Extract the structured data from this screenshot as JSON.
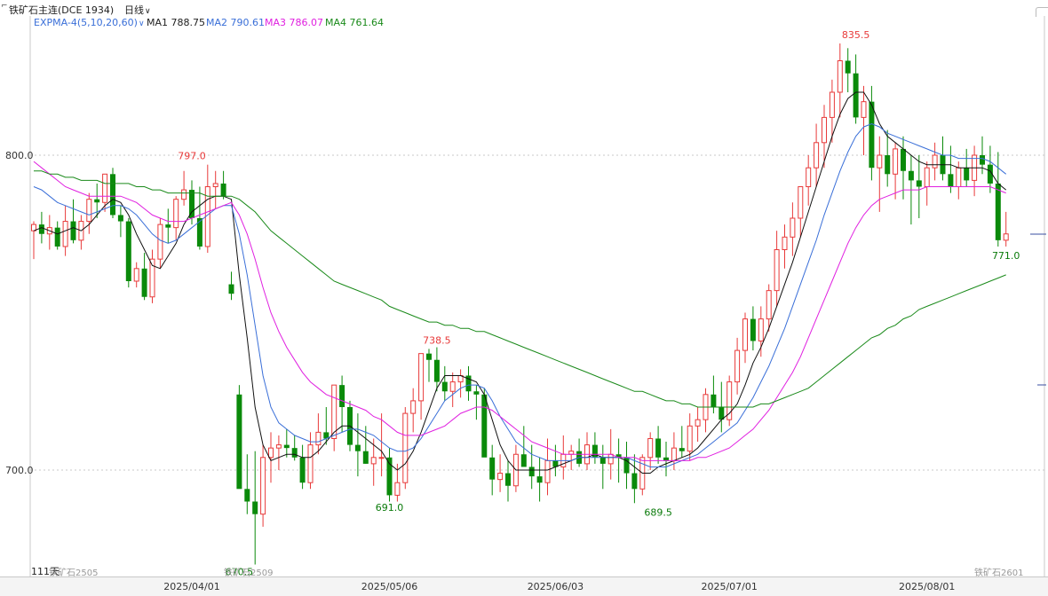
{
  "header": {
    "instrument": "铁矿石主连(DCE 1934)",
    "period": "日线",
    "indicator": "EXPMA-4(5,10,20,60)",
    "ma": [
      {
        "label": "MA1",
        "value": "788.75",
        "color": "#111111"
      },
      {
        "label": "MA2",
        "value": "790.61",
        "color": "#3a6fd8"
      },
      {
        "label": "MA3",
        "value": "786.07",
        "color": "#e020e0"
      },
      {
        "label": "MA4",
        "value": "761.64",
        "color": "#1a8a1a"
      }
    ]
  },
  "footer": {
    "days": "111天",
    "contract_left": "铁矿石2505",
    "contract_mid": "铁矿石2509",
    "contract_right": "铁矿石2601"
  },
  "icons": {
    "expand": "chevron-down-icon",
    "top_left": "corner-icon"
  },
  "colors": {
    "up": "#e83a3a",
    "down": "#0a8a0a",
    "grid": "#c8c8c8",
    "ma1": "#111111",
    "ma2": "#3a6fd8",
    "ma3": "#e020e0",
    "ma4": "#1a8a1a"
  },
  "chart_data": {
    "type": "candlestick",
    "yticks": [
      800,
      700
    ],
    "ylim": [
      665,
      850
    ],
    "xticks": [
      "2025/04/01",
      "2025/05/06",
      "2025/06/03",
      "2025/07/01",
      "2025/08/01"
    ],
    "xtick_index": [
      20,
      45,
      66,
      88,
      113
    ],
    "annotations": [
      {
        "index": 20,
        "value": 797.0,
        "label": "797.0",
        "kind": "high"
      },
      {
        "index": 26,
        "value": 670.5,
        "label": "670.5",
        "kind": "low"
      },
      {
        "index": 45,
        "value": 691.0,
        "label": "691.0",
        "kind": "low"
      },
      {
        "index": 51,
        "value": 738.5,
        "label": "738.5",
        "kind": "high"
      },
      {
        "index": 79,
        "value": 689.5,
        "label": "689.5",
        "kind": "low"
      },
      {
        "index": 104,
        "value": 835.5,
        "label": "835.5",
        "kind": "high"
      },
      {
        "index": 123,
        "value": 771.0,
        "label": "771.0",
        "kind": "low"
      }
    ],
    "candles": [
      [
        776,
        779,
        767,
        778
      ],
      [
        778,
        782,
        772,
        775
      ],
      [
        775,
        781,
        770,
        777
      ],
      [
        777,
        779,
        770,
        771
      ],
      [
        771,
        784,
        768,
        779
      ],
      [
        779,
        786,
        772,
        773
      ],
      [
        773,
        781,
        770,
        779
      ],
      [
        779,
        788,
        775,
        786
      ],
      [
        786,
        791,
        780,
        785
      ],
      [
        785,
        792,
        782,
        794
      ],
      [
        794,
        796,
        780,
        781
      ],
      [
        781,
        784,
        774,
        779
      ],
      [
        779,
        780,
        758,
        760
      ],
      [
        760,
        766,
        758,
        764
      ],
      [
        764,
        769,
        754,
        755
      ],
      [
        755,
        770,
        753,
        767
      ],
      [
        767,
        780,
        764,
        778
      ],
      [
        778,
        783,
        772,
        777
      ],
      [
        777,
        787,
        773,
        786
      ],
      [
        786,
        795,
        784,
        789
      ],
      [
        789,
        792,
        778,
        780
      ],
      [
        780,
        790,
        770,
        771
      ],
      [
        771,
        797,
        769,
        790
      ],
      [
        790,
        795,
        783,
        791
      ],
      [
        791,
        795,
        786,
        787
      ],
      [
        759,
        763,
        754,
        756
      ],
      [
        724,
        727,
        718,
        694
      ],
      [
        694,
        705,
        686,
        690
      ],
      [
        690,
        706,
        670,
        686
      ],
      [
        686,
        708,
        682,
        704
      ],
      [
        704,
        712,
        696,
        707
      ],
      [
        707,
        711,
        700,
        708
      ],
      [
        708,
        713,
        704,
        707
      ],
      [
        707,
        711,
        703,
        704
      ],
      [
        704,
        708,
        694,
        696
      ],
      [
        696,
        712,
        694,
        708
      ],
      [
        708,
        718,
        705,
        712
      ],
      [
        712,
        720,
        708,
        710
      ],
      [
        710,
        727,
        706,
        727
      ],
      [
        727,
        730,
        712,
        720
      ],
      [
        720,
        722,
        706,
        708
      ],
      [
        708,
        718,
        698,
        706
      ],
      [
        706,
        714,
        702,
        702
      ],
      [
        702,
        710,
        695,
        704
      ],
      [
        704,
        718,
        698,
        704
      ],
      [
        704,
        707,
        690,
        692
      ],
      [
        692,
        702,
        690,
        696
      ],
      [
        696,
        720,
        694,
        718
      ],
      [
        718,
        726,
        712,
        722
      ],
      [
        722,
        737,
        716,
        737
      ],
      [
        737,
        738.5,
        728,
        735
      ],
      [
        735,
        739,
        725,
        728
      ],
      [
        728,
        733,
        722,
        725
      ],
      [
        725,
        731,
        720,
        728
      ],
      [
        728,
        732,
        723,
        730
      ],
      [
        730,
        733,
        722,
        725
      ],
      [
        725,
        727,
        716,
        724
      ],
      [
        724,
        726,
        708,
        704
      ],
      [
        704,
        708,
        692,
        697
      ],
      [
        697,
        705,
        693,
        699
      ],
      [
        699,
        703,
        690,
        695
      ],
      [
        695,
        708,
        693,
        705
      ],
      [
        705,
        714,
        703,
        701
      ],
      [
        701,
        708,
        694,
        698
      ],
      [
        698,
        704,
        690,
        696
      ],
      [
        696,
        710,
        692,
        703
      ],
      [
        703,
        708,
        698,
        701
      ],
      [
        701,
        711,
        697,
        705
      ],
      [
        705,
        708,
        700,
        706
      ],
      [
        706,
        710,
        701,
        702
      ],
      [
        702,
        712,
        700,
        708
      ],
      [
        708,
        712,
        702,
        704
      ],
      [
        704,
        708,
        694,
        702
      ],
      [
        702,
        713,
        697,
        705
      ],
      [
        705,
        710,
        696,
        704
      ],
      [
        704,
        709,
        694,
        699
      ],
      [
        699,
        705,
        689.5,
        694
      ],
      [
        694,
        705,
        692,
        704
      ],
      [
        704,
        712,
        700,
        710
      ],
      [
        710,
        714,
        702,
        704
      ],
      [
        704,
        709,
        698,
        703
      ],
      [
        703,
        712,
        700,
        707
      ],
      [
        707,
        714,
        704,
        706
      ],
      [
        706,
        718,
        703,
        714
      ],
      [
        714,
        720,
        709,
        716
      ],
      [
        716,
        726,
        712,
        724
      ],
      [
        724,
        730,
        718,
        720
      ],
      [
        720,
        728,
        712,
        716
      ],
      [
        716,
        730,
        714,
        728
      ],
      [
        728,
        742,
        724,
        738
      ],
      [
        738,
        750,
        734,
        748
      ],
      [
        748,
        752,
        738,
        741
      ],
      [
        741,
        752,
        736,
        748
      ],
      [
        748,
        759,
        744,
        757
      ],
      [
        757,
        776,
        752,
        770
      ],
      [
        770,
        778,
        764,
        774
      ],
      [
        774,
        785,
        768,
        780
      ],
      [
        780,
        790,
        774,
        790
      ],
      [
        790,
        800,
        784,
        796
      ],
      [
        796,
        810,
        790,
        804
      ],
      [
        804,
        816,
        796,
        812
      ],
      [
        812,
        824,
        804,
        820
      ],
      [
        820,
        835.5,
        812,
        830
      ],
      [
        830,
        834,
        820,
        826
      ],
      [
        826,
        832,
        810,
        812
      ],
      [
        812,
        822,
        800,
        817
      ],
      [
        817,
        822,
        792,
        796
      ],
      [
        796,
        806,
        782,
        800
      ],
      [
        800,
        808,
        790,
        794
      ],
      [
        794,
        804,
        786,
        802
      ],
      [
        802,
        806,
        786,
        795
      ],
      [
        795,
        800,
        778,
        792
      ],
      [
        792,
        800,
        780,
        790
      ],
      [
        790,
        798,
        784,
        796
      ],
      [
        796,
        804,
        792,
        800
      ],
      [
        800,
        806,
        792,
        794
      ],
      [
        794,
        803,
        788,
        790
      ],
      [
        790,
        798,
        786,
        796
      ],
      [
        796,
        802,
        790,
        792
      ],
      [
        792,
        803,
        787,
        800
      ],
      [
        800,
        806,
        794,
        797
      ],
      [
        797,
        803,
        788,
        791
      ],
      [
        791,
        801,
        771,
        773
      ],
      [
        773,
        782,
        771,
        775
      ]
    ],
    "series": [
      {
        "name": "MA1",
        "values": [
          776,
          777,
          776,
          775,
          776,
          777,
          776,
          778,
          781,
          784,
          786,
          785,
          781,
          775,
          770,
          765,
          764,
          768,
          772,
          778,
          782,
          784,
          786,
          787,
          787,
          786,
          762,
          742,
          720,
          708,
          703,
          704,
          705,
          705,
          704,
          704,
          706,
          709,
          712,
          714,
          714,
          712,
          710,
          708,
          706,
          702,
          700,
          702,
          706,
          712,
          719,
          726,
          730,
          730,
          730,
          729,
          728,
          724,
          716,
          708,
          703,
          700,
          700,
          700,
          700,
          700,
          701,
          702,
          703,
          704,
          704,
          705,
          704,
          704,
          704,
          703,
          701,
          699,
          699,
          701,
          702,
          703,
          704,
          705,
          707,
          710,
          713,
          716,
          718,
          721,
          727,
          734,
          739,
          745,
          752,
          759,
          766,
          774,
          782,
          790,
          798,
          806,
          813,
          818,
          820,
          820,
          816,
          810,
          806,
          804,
          802,
          800,
          798,
          797,
          797,
          797,
          797,
          796,
          796,
          796,
          796,
          795,
          791,
          789
        ]
      },
      {
        "name": "MA2",
        "values": [
          790,
          789,
          787,
          785,
          784,
          783,
          782,
          781,
          782,
          783,
          784,
          784,
          783,
          781,
          778,
          775,
          773,
          772,
          773,
          775,
          777,
          779,
          781,
          783,
          784,
          784,
          775,
          762,
          746,
          730,
          720,
          715,
          713,
          711,
          710,
          709,
          709,
          710,
          711,
          712,
          713,
          713,
          712,
          711,
          709,
          707,
          706,
          706,
          707,
          710,
          714,
          718,
          722,
          724,
          726,
          727,
          727,
          726,
          722,
          717,
          713,
          709,
          707,
          705,
          704,
          703,
          703,
          703,
          703,
          704,
          704,
          704,
          704,
          704,
          704,
          704,
          703,
          702,
          701,
          701,
          701,
          702,
          703,
          704,
          705,
          707,
          709,
          711,
          713,
          715,
          719,
          723,
          728,
          733,
          739,
          745,
          752,
          759,
          766,
          773,
          781,
          788,
          795,
          801,
          806,
          809,
          810,
          809,
          807,
          806,
          805,
          804,
          803,
          802,
          801,
          800,
          800,
          799,
          799,
          799,
          799,
          798,
          796,
          794
        ]
      },
      {
        "name": "MA3",
        "values": [
          798,
          796,
          794,
          792,
          790,
          789,
          788,
          787,
          787,
          787,
          787,
          787,
          786,
          785,
          783,
          781,
          780,
          779,
          779,
          779,
          780,
          781,
          782,
          783,
          784,
          785,
          781,
          775,
          767,
          758,
          750,
          744,
          739,
          735,
          731,
          728,
          726,
          724,
          723,
          722,
          721,
          720,
          719,
          717,
          716,
          714,
          712,
          711,
          711,
          711,
          712,
          713,
          714,
          716,
          718,
          719,
          720,
          720,
          719,
          717,
          715,
          713,
          711,
          709,
          708,
          707,
          706,
          705,
          705,
          705,
          705,
          705,
          705,
          705,
          704,
          704,
          704,
          703,
          703,
          703,
          703,
          703,
          703,
          703,
          704,
          704,
          705,
          706,
          707,
          709,
          711,
          713,
          716,
          719,
          723,
          727,
          731,
          736,
          742,
          748,
          754,
          760,
          766,
          772,
          777,
          781,
          784,
          786,
          787,
          788,
          789,
          789,
          789,
          790,
          790,
          790,
          790,
          790,
          790,
          790,
          790,
          790,
          789,
          788
        ]
      },
      {
        "name": "MA4",
        "values": [
          795,
          795,
          794,
          794,
          793,
          793,
          792,
          792,
          792,
          791,
          791,
          791,
          791,
          790,
          790,
          789,
          789,
          788,
          788,
          788,
          788,
          788,
          787,
          787,
          787,
          787,
          786,
          784,
          782,
          779,
          776,
          774,
          772,
          770,
          768,
          766,
          764,
          762,
          760,
          759,
          758,
          757,
          756,
          755,
          754,
          752,
          751,
          750,
          749,
          748,
          747,
          747,
          746,
          746,
          745,
          745,
          744,
          744,
          743,
          742,
          741,
          740,
          739,
          738,
          737,
          736,
          735,
          734,
          733,
          732,
          731,
          730,
          729,
          728,
          727,
          726,
          725,
          725,
          724,
          723,
          722,
          722,
          721,
          721,
          720,
          720,
          720,
          720,
          720,
          720,
          720,
          720,
          721,
          721,
          722,
          723,
          724,
          725,
          726,
          728,
          730,
          732,
          734,
          736,
          738,
          740,
          742,
          743,
          745,
          746,
          748,
          749,
          751,
          752,
          753,
          754,
          755,
          756,
          757,
          758,
          759,
          760,
          761,
          762
        ]
      }
    ]
  }
}
